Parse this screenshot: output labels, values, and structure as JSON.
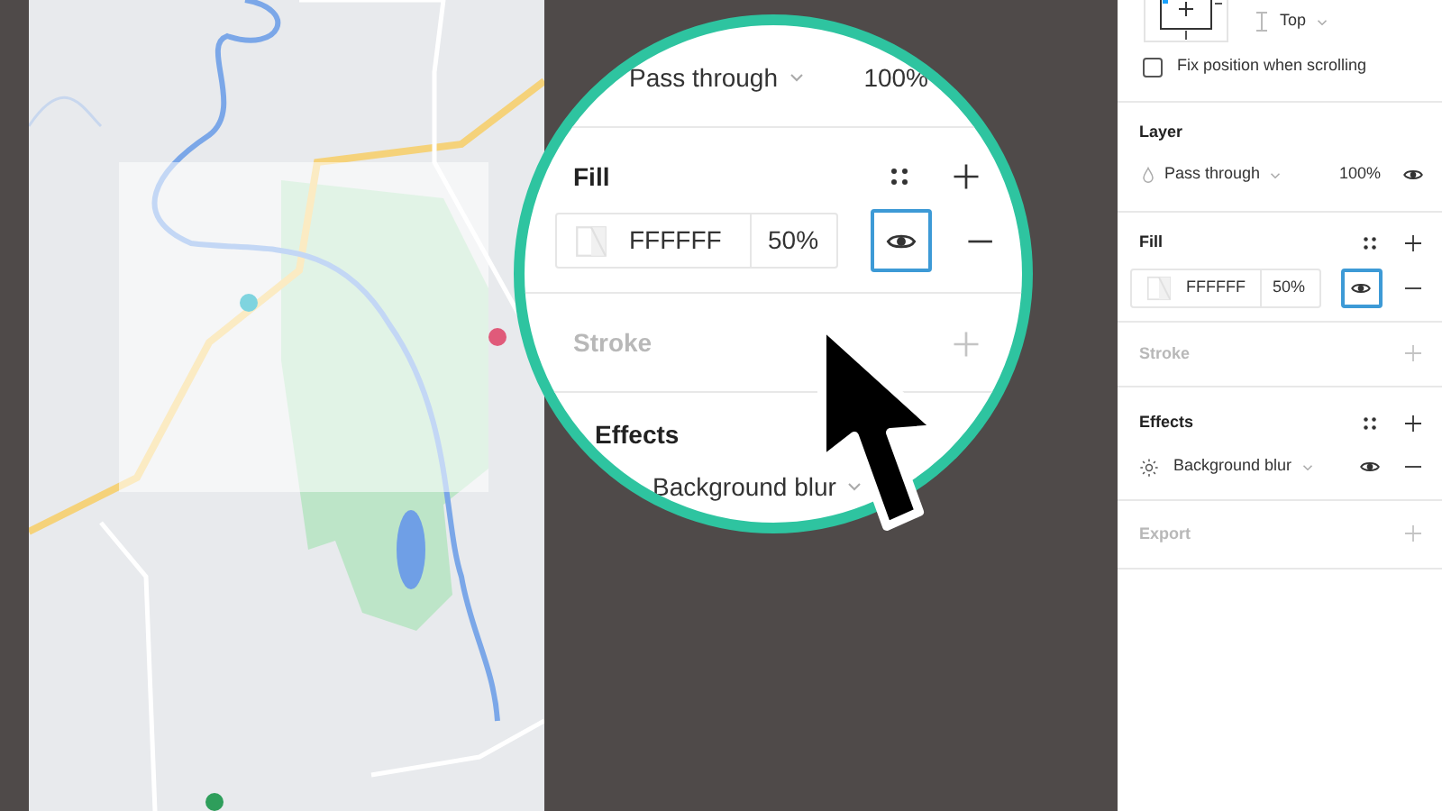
{
  "magnifier": {
    "blend": "Pass through",
    "opacity": "100%",
    "fill_title": "Fill",
    "fill_hex": "FFFFFF",
    "fill_opacity": "50%",
    "fill_eye_focused": true,
    "stroke_title": "Stroke",
    "stroke_disabled": true,
    "effects_title": "Effects",
    "effect": "Background blur"
  },
  "panel": {
    "constraint": "Top",
    "fix_position": {
      "label": "Fix position when scrolling",
      "checked": false
    },
    "layer": {
      "title": "Layer",
      "blend": "Pass through",
      "opacity": "100%"
    },
    "fill": {
      "title": "Fill",
      "hex": "FFFFFF",
      "opacity": "50%",
      "eye_focused": true
    },
    "stroke": {
      "title": "Stroke",
      "disabled": true
    },
    "effects": {
      "title": "Effects",
      "items": [
        {
          "name": "Background blur"
        }
      ]
    },
    "export": {
      "title": "Export",
      "disabled": true
    }
  }
}
